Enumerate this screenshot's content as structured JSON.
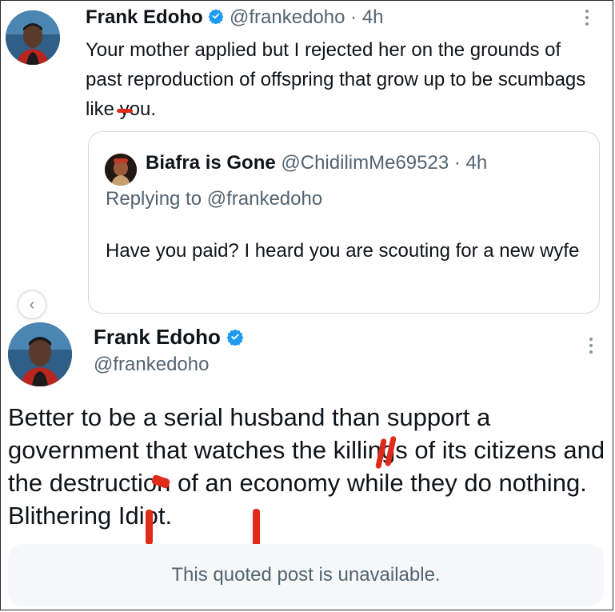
{
  "tweet1": {
    "name": "Frank Edoho",
    "handle": "@frankedoho",
    "time": "· 4h",
    "body": "Your mother applied but I rejected her on the grounds of past reproduction of  offspring that grow up to be scumbags like you."
  },
  "quoted": {
    "name": "Biafra is Gone",
    "handle": "@ChidilimMe69523",
    "time": "· 4h",
    "replying": "Replying to @frankedoho",
    "body": "Have you paid? I heard you are scouting for a new wyfe"
  },
  "tweet2": {
    "name": "Frank Edoho",
    "handle": "@frankedoho",
    "body": "Better to be a serial husband than support a government that watches the killings of its citizens and the destruction of an economy while they do nothing. Blithering Idiot.",
    "quote_unavailable": "This quoted post is unavailable."
  },
  "colors": {
    "verified": "#1d9bf0",
    "muted": "#536471",
    "annotation": "#e02b1b"
  },
  "icons": {
    "verified": "verified-badge-icon",
    "more": "more-options-icon",
    "back": "chevron-left-icon"
  }
}
